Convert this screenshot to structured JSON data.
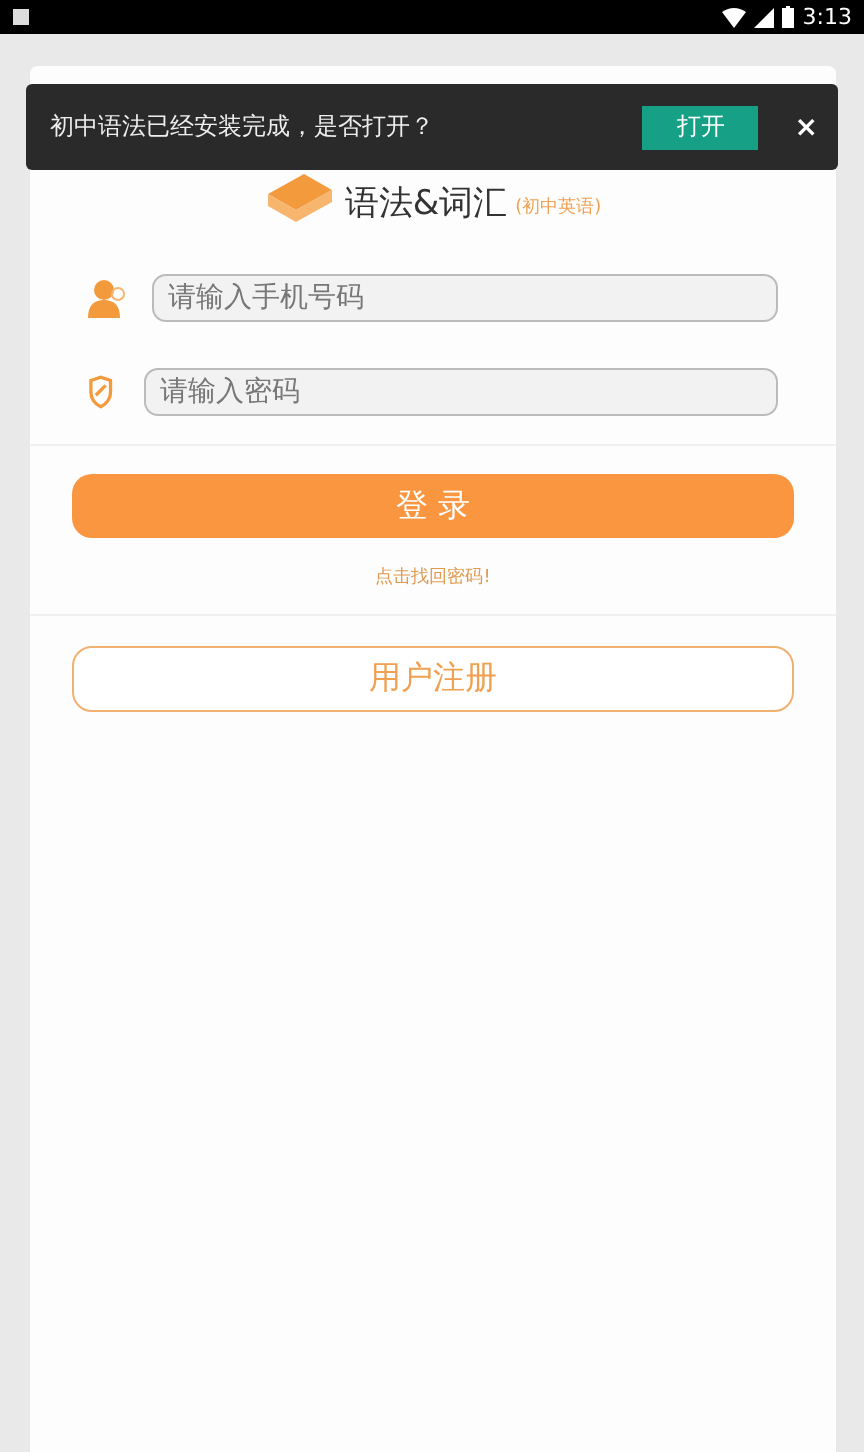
{
  "status_bar": {
    "time": "3:13"
  },
  "toast": {
    "message": "初中语法已经安装完成，是否打开？",
    "action": "打开",
    "close": "×"
  },
  "logo": {
    "title": "语法&词汇",
    "subtitle": "(初中英语)"
  },
  "form": {
    "phone": {
      "placeholder": "请输入手机号码"
    },
    "password": {
      "placeholder": "请输入密码"
    },
    "login": "登 录",
    "forgot": "点击找回密码!",
    "register": "用户注册"
  }
}
